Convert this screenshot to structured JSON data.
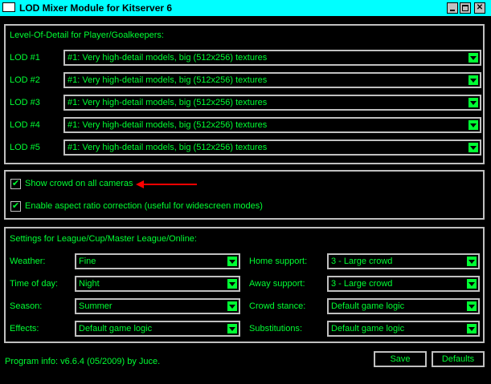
{
  "window": {
    "title": "LOD Mixer Module for Kitserver 6",
    "controls": [
      "minimize-icon",
      "maximize-icon",
      "close-icon"
    ]
  },
  "lod": {
    "group_label": "Level-Of-Detail for Player/Goalkeepers:",
    "rows": [
      {
        "label": "LOD #1",
        "value": "#1: Very high-detail models, big (512x256) textures"
      },
      {
        "label": "LOD #2",
        "value": "#1: Very high-detail models, big (512x256) textures"
      },
      {
        "label": "LOD #3",
        "value": "#1: Very high-detail models, big (512x256) textures"
      },
      {
        "label": "LOD #4",
        "value": "#1: Very high-detail models, big (512x256) textures"
      },
      {
        "label": "LOD #5",
        "value": "#1: Very high-detail models, big (512x256) textures"
      }
    ]
  },
  "options": {
    "show_crowd": {
      "label": "Show crowd on all cameras",
      "checked": true
    },
    "aspect": {
      "label": "Enable aspect ratio correction (useful for widescreen modes)",
      "checked": true
    },
    "check_glyph": "✔"
  },
  "settings": {
    "group_label": "Settings for League/Cup/Master League/Online:",
    "weather": {
      "label": "Weather:",
      "value": "Fine"
    },
    "time_of_day": {
      "label": "Time of day:",
      "value": "Night"
    },
    "season": {
      "label": "Season:",
      "value": "Summer"
    },
    "effects": {
      "label": "Effects:",
      "value": "Default game logic"
    },
    "home_support": {
      "label": "Home support:",
      "value": "3 - Large crowd"
    },
    "away_support": {
      "label": "Away support:",
      "value": "3 - Large crowd"
    },
    "crowd_stance": {
      "label": "Crowd stance:",
      "value": "Default game logic"
    },
    "substitutions": {
      "label": "Substitutions:",
      "value": "Default game logic"
    }
  },
  "footer": {
    "info": "Program info: v6.6.4 (05/2009) by Juce.",
    "save_label": "Save",
    "defaults_label": "Defaults"
  },
  "colors": {
    "title_bg": "#00ffff",
    "text": "#00ff33",
    "border": "#c0c0c0",
    "annotation_arrow": "#ff0000"
  }
}
